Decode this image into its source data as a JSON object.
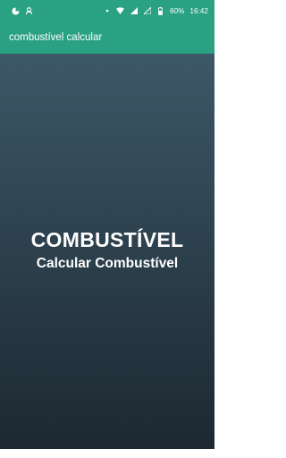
{
  "status_bar": {
    "left_icons": [
      "pie-chart-icon",
      "notification-app-icon"
    ],
    "right_icons": [
      "dot-icon",
      "wifi-icon",
      "signal-icon",
      "signal-no-service-icon",
      "battery-icon"
    ],
    "battery": "60%",
    "time": "16:42"
  },
  "app_bar": {
    "title": "combustível calcular"
  },
  "main": {
    "headline": "COMBUSTÍVEL",
    "subheadline": "Calcular Combustível"
  },
  "colors": {
    "accent": "#2aa183",
    "background_top": "#3d5867",
    "background_bottom": "#1d2831",
    "text": "#ffffff"
  }
}
